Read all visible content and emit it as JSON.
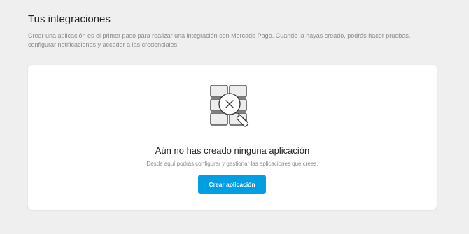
{
  "header": {
    "title": "Tus integraciones",
    "description": "Crear una aplicación es el primer paso para realizar una integración con Mercado Pago. Cuando la hayas creado, podrás hacer pruebas, configurar notificaciones y acceder a las credenciales."
  },
  "empty_state": {
    "illustration_icon": "no-results-search-grid-icon",
    "title": "Aún no has creado ninguna aplicación",
    "description": "Desde aquí podrás configurar y gestionar las aplicaciones que crees.",
    "button_label": "Crear aplicación"
  },
  "colors": {
    "background": "#efefef",
    "card": "#ffffff",
    "primary_button": "#009ee3",
    "muted_text": "#8a8a8a",
    "text": "#222222"
  }
}
